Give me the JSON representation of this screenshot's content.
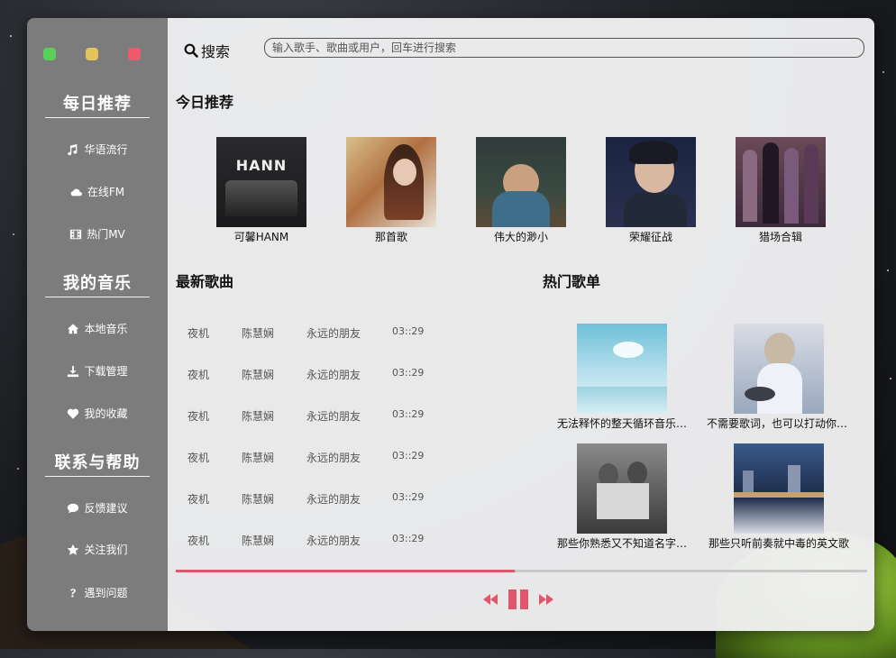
{
  "window": {
    "traffic_lights": [
      {
        "name": "window-minimize",
        "color": "#5ad05a"
      },
      {
        "name": "window-maximize",
        "color": "#e6c35a"
      },
      {
        "name": "window-close",
        "color": "#ee5a6b"
      }
    ]
  },
  "sidebar": {
    "sections": [
      {
        "title": "每日推荐",
        "items": [
          {
            "label": "华语流行",
            "icon": "music-icon"
          },
          {
            "label": "在线FM",
            "icon": "cloud-icon"
          },
          {
            "label": "热门MV",
            "icon": "film-icon"
          }
        ]
      },
      {
        "title": "我的音乐",
        "items": [
          {
            "label": "本地音乐",
            "icon": "home-icon"
          },
          {
            "label": "下载管理",
            "icon": "download-icon"
          },
          {
            "label": "我的收藏",
            "icon": "heart-icon"
          }
        ]
      },
      {
        "title": "联系与帮助",
        "items": [
          {
            "label": "反馈建议",
            "icon": "comment-icon"
          },
          {
            "label": "关注我们",
            "icon": "star-icon"
          },
          {
            "label": "遇到问题",
            "icon": "question-icon"
          }
        ]
      }
    ]
  },
  "search": {
    "label": "搜索",
    "placeholder": "输入歌手、歌曲或用户，回车进行搜索"
  },
  "today": {
    "title": "今日推荐",
    "albums": [
      {
        "name": "可馨HANM"
      },
      {
        "name": "那首歌"
      },
      {
        "name": "伟大的渺小"
      },
      {
        "name": "荣耀征战"
      },
      {
        "name": "猎场合辑"
      }
    ]
  },
  "latest": {
    "title": "最新歌曲",
    "songs": [
      {
        "title": "夜机",
        "artist": "陈慧娴",
        "album": "永远的朋友",
        "duration": "03::29"
      },
      {
        "title": "夜机",
        "artist": "陈慧娴",
        "album": "永远的朋友",
        "duration": "03::29"
      },
      {
        "title": "夜机",
        "artist": "陈慧娴",
        "album": "永远的朋友",
        "duration": "03::29"
      },
      {
        "title": "夜机",
        "artist": "陈慧娴",
        "album": "永远的朋友",
        "duration": "03::29"
      },
      {
        "title": "夜机",
        "artist": "陈慧娴",
        "album": "永远的朋友",
        "duration": "03::29"
      },
      {
        "title": "夜机",
        "artist": "陈慧娴",
        "album": "永远的朋友",
        "duration": "03::29"
      }
    ]
  },
  "hot": {
    "title": "热门歌单",
    "playlists": [
      {
        "name": "无法释怀的整天循环音乐…"
      },
      {
        "name": "不需要歌词，也可以打动你的心"
      },
      {
        "name": "那些你熟悉又不知道名字…"
      },
      {
        "name": "那些只听前奏就中毒的英文歌"
      }
    ]
  },
  "player": {
    "progress": 0.49,
    "accent": "#e0566a"
  }
}
